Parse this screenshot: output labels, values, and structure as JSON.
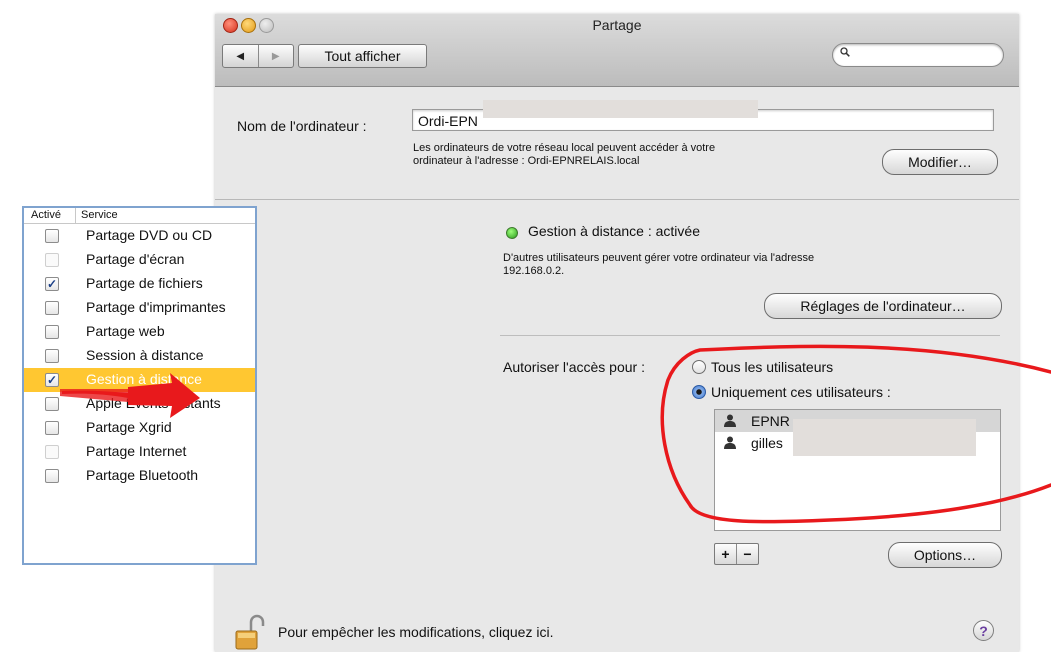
{
  "window": {
    "title": "Partage",
    "nav_back": "◀",
    "nav_forward": "▶",
    "show_all_label": "Tout afficher",
    "search_placeholder": ""
  },
  "computer_name": {
    "label": "Nom de l'ordinateur :",
    "value": "Ordi-EPN",
    "description_line1": "Les ordinateurs de votre réseau local peuvent accéder à votre",
    "description_line2": "ordinateur à l'adresse : Ordi-EPNRELAIS.local",
    "edit_button": "Modifier…"
  },
  "services": {
    "header_active": "Activé",
    "header_service": "Service",
    "items": [
      {
        "label": "Partage DVD ou CD",
        "checked": false,
        "dim": false,
        "selected": false
      },
      {
        "label": "Partage d'écran",
        "checked": false,
        "dim": true,
        "selected": false
      },
      {
        "label": "Partage de fichiers",
        "checked": true,
        "dim": false,
        "selected": false
      },
      {
        "label": "Partage d'imprimantes",
        "checked": false,
        "dim": false,
        "selected": false
      },
      {
        "label": "Partage web",
        "checked": false,
        "dim": false,
        "selected": false
      },
      {
        "label": "Session à distance",
        "checked": false,
        "dim": false,
        "selected": false
      },
      {
        "label": "Gestion à distance",
        "checked": true,
        "dim": false,
        "selected": true
      },
      {
        "label": "Apple Events distants",
        "checked": false,
        "dim": false,
        "selected": false
      },
      {
        "label": "Partage Xgrid",
        "checked": false,
        "dim": false,
        "selected": false
      },
      {
        "label": "Partage Internet",
        "checked": false,
        "dim": true,
        "selected": false
      },
      {
        "label": "Partage Bluetooth",
        "checked": false,
        "dim": false,
        "selected": false
      }
    ],
    "check_glyph": "✓"
  },
  "remote": {
    "status": "Gestion à distance : activée",
    "status_color": "#2a9c1c",
    "desc_line1": "D'autres utilisateurs peuvent gérer votre ordinateur via l'adresse",
    "desc_line2": "192.168.0.2.",
    "settings_button": "Réglages de l'ordinateur…"
  },
  "access": {
    "label": "Autoriser l'accès pour :",
    "option_all": "Tous les utilisateurs",
    "option_only": "Uniquement ces utilisateurs :",
    "selected_option": "only",
    "users": [
      "EPNR",
      "gilles"
    ],
    "add": "+",
    "remove": "−",
    "options_button": "Options…"
  },
  "footer": {
    "lock_text": "Pour empêcher les modifications, cliquez ici.",
    "help": "?"
  },
  "annotation": {
    "color": "#e8191c",
    "icons": [
      "red-arrow-annotation",
      "red-freehand-circle-annotation"
    ]
  }
}
